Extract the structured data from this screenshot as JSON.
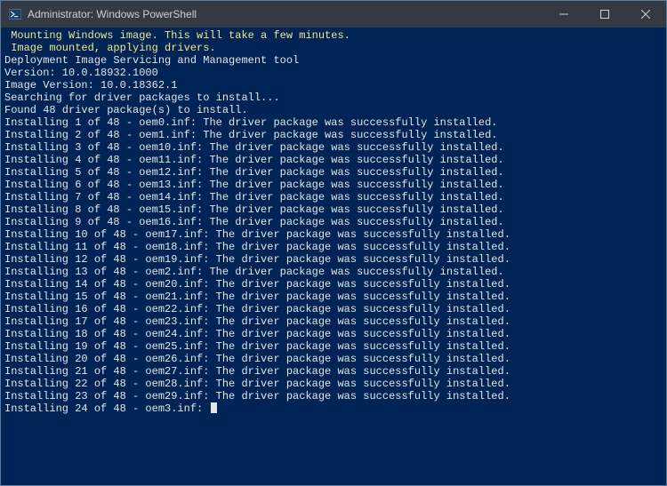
{
  "window": {
    "title": "Administrator: Windows PowerShell"
  },
  "icons": {
    "app": "powershell-icon",
    "minimize": "minimize-icon",
    "maximize": "maximize-icon",
    "close": "close-icon"
  },
  "colors": {
    "terminal_bg": "#012456",
    "titlebar_bg": "#333a44",
    "fg_white": "#e5e5e5",
    "fg_yellow": "#f0e68c"
  },
  "terminal": {
    "lines": [
      {
        "text": "",
        "color": "white"
      },
      {
        "text": "",
        "color": "white"
      },
      {
        "text": "",
        "color": "white"
      },
      {
        "text": "",
        "color": "white"
      },
      {
        "text": " Mounting Windows image. This will take a few minutes.",
        "color": "yellow"
      },
      {
        "text": "",
        "color": "white"
      },
      {
        "text": " Image mounted, applying drivers.",
        "color": "yellow"
      },
      {
        "text": "",
        "color": "white"
      },
      {
        "text": "Deployment Image Servicing and Management tool",
        "color": "white"
      },
      {
        "text": "Version: 10.0.18932.1000",
        "color": "white"
      },
      {
        "text": "",
        "color": "white"
      },
      {
        "text": "Image Version: 10.0.18362.1",
        "color": "white"
      },
      {
        "text": "",
        "color": "white"
      },
      {
        "text": "Searching for driver packages to install...",
        "color": "white"
      },
      {
        "text": "Found 48 driver package(s) to install.",
        "color": "white"
      },
      {
        "text": "Installing 1 of 48 - oem0.inf: The driver package was successfully installed.",
        "color": "white"
      },
      {
        "text": "Installing 2 of 48 - oem1.inf: The driver package was successfully installed.",
        "color": "white"
      },
      {
        "text": "Installing 3 of 48 - oem10.inf: The driver package was successfully installed.",
        "color": "white"
      },
      {
        "text": "Installing 4 of 48 - oem11.inf: The driver package was successfully installed.",
        "color": "white"
      },
      {
        "text": "Installing 5 of 48 - oem12.inf: The driver package was successfully installed.",
        "color": "white"
      },
      {
        "text": "Installing 6 of 48 - oem13.inf: The driver package was successfully installed.",
        "color": "white"
      },
      {
        "text": "Installing 7 of 48 - oem14.inf: The driver package was successfully installed.",
        "color": "white"
      },
      {
        "text": "Installing 8 of 48 - oem15.inf: The driver package was successfully installed.",
        "color": "white"
      },
      {
        "text": "Installing 9 of 48 - oem16.inf: The driver package was successfully installed.",
        "color": "white"
      },
      {
        "text": "Installing 10 of 48 - oem17.inf: The driver package was successfully installed.",
        "color": "white"
      },
      {
        "text": "Installing 11 of 48 - oem18.inf: The driver package was successfully installed.",
        "color": "white"
      },
      {
        "text": "Installing 12 of 48 - oem19.inf: The driver package was successfully installed.",
        "color": "white"
      },
      {
        "text": "Installing 13 of 48 - oem2.inf: The driver package was successfully installed.",
        "color": "white"
      },
      {
        "text": "Installing 14 of 48 - oem20.inf: The driver package was successfully installed.",
        "color": "white"
      },
      {
        "text": "Installing 15 of 48 - oem21.inf: The driver package was successfully installed.",
        "color": "white"
      },
      {
        "text": "Installing 16 of 48 - oem22.inf: The driver package was successfully installed.",
        "color": "white"
      },
      {
        "text": "Installing 17 of 48 - oem23.inf: The driver package was successfully installed.",
        "color": "white"
      },
      {
        "text": "Installing 18 of 48 - oem24.inf: The driver package was successfully installed.",
        "color": "white"
      },
      {
        "text": "Installing 19 of 48 - oem25.inf: The driver package was successfully installed.",
        "color": "white"
      },
      {
        "text": "Installing 20 of 48 - oem26.inf: The driver package was successfully installed.",
        "color": "white"
      },
      {
        "text": "Installing 21 of 48 - oem27.inf: The driver package was successfully installed.",
        "color": "white"
      },
      {
        "text": "Installing 22 of 48 - oem28.inf: The driver package was successfully installed.",
        "color": "white"
      },
      {
        "text": "Installing 23 of 48 - oem29.inf: The driver package was successfully installed.",
        "color": "white"
      },
      {
        "text": "Installing 24 of 48 - oem3.inf: ",
        "color": "white",
        "cursor": true
      }
    ]
  }
}
